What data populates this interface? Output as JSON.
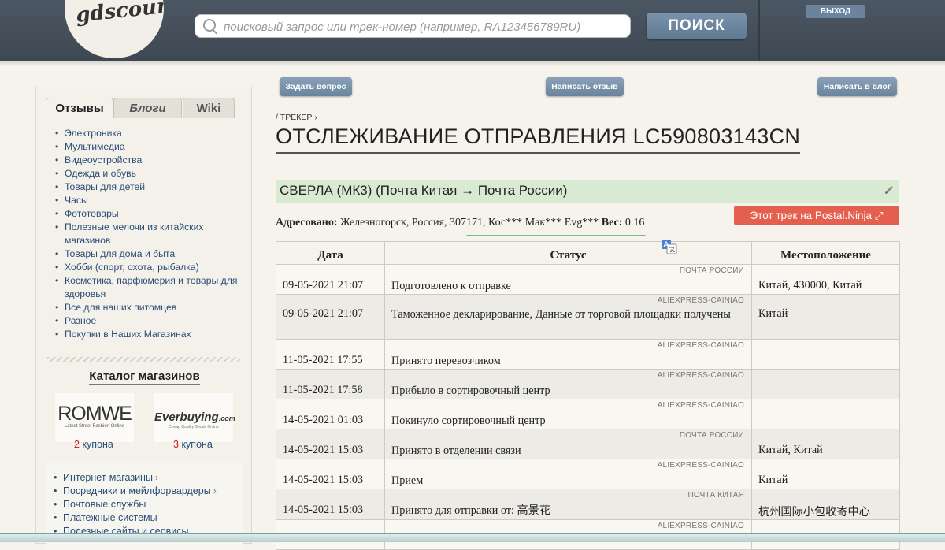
{
  "header": {
    "logo_text": "gdscount",
    "search_placeholder": "поисковый запрос или трек-номер (например, RA123456789RU)",
    "search_button": "ПОИСК",
    "logout_button": "ВЫХОД"
  },
  "sidebar": {
    "tabs": [
      "Отзывы",
      "Блоги",
      "Wiki"
    ],
    "categories": [
      "Электроника",
      "Мультимедиа",
      "Видеоустройства",
      "Одежда и обувь",
      "Товары для детей",
      "Часы",
      "Фототовары",
      "Полезные мелочи из китайских магазинов",
      "Товары для дома и быта",
      "Хобби (спорт, охота, рыбалка)",
      "Косметика, парфюмерия и товары для здоровья",
      "Все для наших питомцев",
      "Разное",
      "Покупки в Наших Магазинах"
    ],
    "catalog_title": "Каталог магазинов",
    "stores": [
      {
        "name": "ROMWE",
        "tagline": "Latest Street Fashion Online",
        "coupon_count": "2",
        "coupon_label": "купона"
      },
      {
        "name": "Everbuying",
        "name_suffix": ".com",
        "tagline": "Cheap Quality Goods Online",
        "coupon_count": "3",
        "coupon_label": "купона"
      }
    ],
    "links": [
      "Интернет-магазины",
      "Посредники и мейлфорвардеры",
      "Почтовые службы",
      "Платежные системы",
      "Полезные сайты и сервисы"
    ]
  },
  "actions": {
    "ask": "Задать вопрос",
    "review": "Написать отзыв",
    "blog": "Написать в блог"
  },
  "breadcrumb": "/ ТРЕКЕР ›",
  "page_title": "ОТСЛЕЖИВАНИЕ ОТПРАВЛЕНИЯ LC590803143CN",
  "item": {
    "title": "СВЕРЛА (МК3) (Почта Китая → Почта России)"
  },
  "address": {
    "label": "Адресовано:",
    "value": "Железногорск, Россия, 307171, Кос*** Мак*** Evg***",
    "weight_label": "Вес:",
    "weight_value": "0.16"
  },
  "postal_ninja_button": "Этот трек на Postal.Ninja ⤢",
  "table": {
    "headers": [
      "Дата",
      "Статус",
      "Местоположение"
    ],
    "rows": [
      {
        "source": "ПОЧТА РОССИИ",
        "date": "09-05-2021 21:07",
        "status": "Подготовлено к отправке",
        "location": "Китай, 430000, Китай"
      },
      {
        "source": "ALIEXPRESS-CAINIAO",
        "date": "09-05-2021 21:07",
        "status": "Таможенное декларирование, Данные от торговой площадки получены",
        "location": "Китай"
      },
      {
        "source": "ALIEXPRESS-CAINIAO",
        "date": "11-05-2021 17:55",
        "status": "Принято перевозчиком",
        "location": ""
      },
      {
        "source": "ALIEXPRESS-CAINIAO",
        "date": "11-05-2021 17:58",
        "status": "Прибыло в сортировочный центр",
        "location": ""
      },
      {
        "source": "ALIEXPRESS-CAINIAO",
        "date": "14-05-2021 01:03",
        "status": "Покинуло сортировочный центр",
        "location": ""
      },
      {
        "source": "ПОЧТА РОССИИ",
        "date": "14-05-2021 15:03",
        "status": "Принято в отделении связи",
        "location": "Китай, Китай"
      },
      {
        "source": "ALIEXPRESS-CAINIAO",
        "date": "14-05-2021 15:03",
        "status": "Прием",
        "location": "Китай"
      },
      {
        "source": "ПОЧТА КИТАЯ",
        "date": "14-05-2021 15:03",
        "status": "Принято для отправки от: 高景花",
        "location": "杭州国际小包收寄中心"
      },
      {
        "source": "ALIEXPRESS-CAINIAO",
        "date": "",
        "status": "",
        "location": ""
      }
    ]
  },
  "colors": {
    "header_bg": "#47525e",
    "accent_button": "#6a849d",
    "item_bar": "#d8ead1",
    "postal_ninja": "#e55f4f",
    "link": "#2a4e77"
  }
}
